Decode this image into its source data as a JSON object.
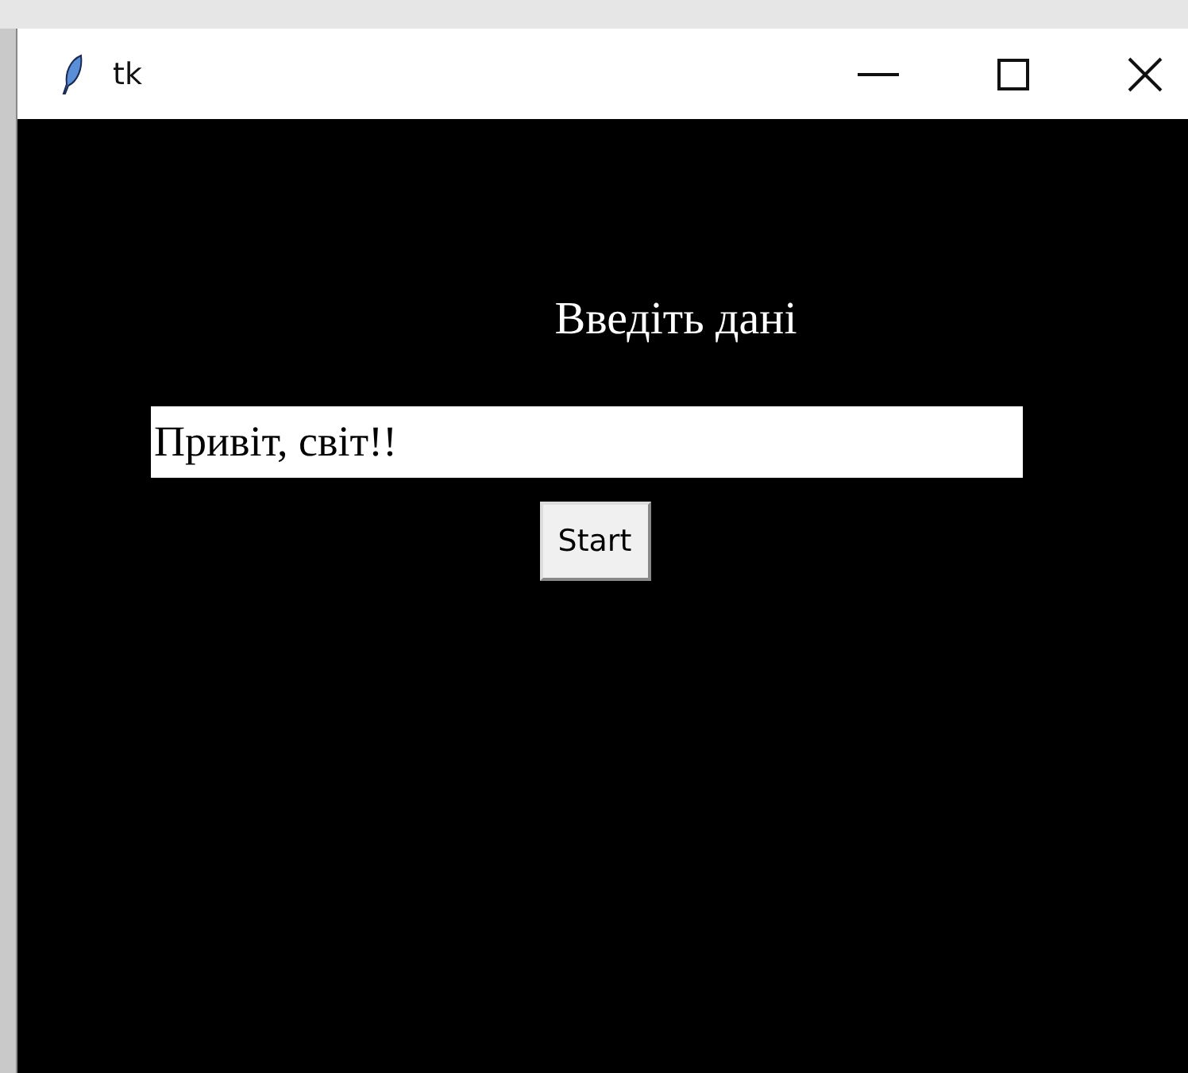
{
  "window": {
    "title": "tk"
  },
  "heading": "Введіть дані",
  "entry": {
    "value": "Привіт, світ!!"
  },
  "button": {
    "label": "Start"
  }
}
